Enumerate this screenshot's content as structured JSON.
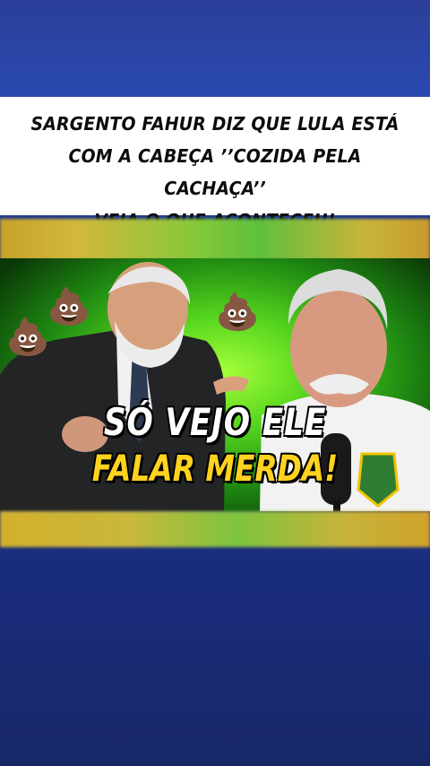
{
  "headline": {
    "line1": "SARGENTO FAHUR DIZ QUE LULA ESTÁ",
    "line2": "COM A CABEÇA ’’COZIDA PELA CACHAÇA’’",
    "line3": "VEJA O QUE ACONTECEU!"
  },
  "thumbnail": {
    "caption_line1": "SÓ VEJO ELE",
    "caption_line2": "FALAR MERDA!",
    "emojis": [
      "💩",
      "💩",
      "💩"
    ],
    "badge_icon": "police-badge-icon",
    "microphone_icon": "microphone-icon"
  },
  "colors": {
    "background": "#1c3286",
    "headline_box": "#ffffff",
    "caption_white": "#ffffff",
    "caption_yellow": "#ffd21f",
    "glow_green": "#56d61e"
  }
}
